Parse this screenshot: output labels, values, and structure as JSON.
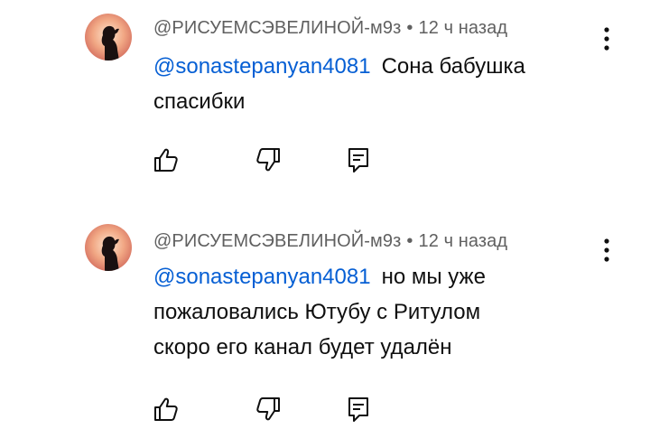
{
  "comments": [
    {
      "author": "@РИСУЕМСЭВЕЛИНОЙ-м9з",
      "separator": "•",
      "time": "12 ч назад",
      "mention": "@sonastepanyan4081",
      "lines": [
        "Сона бабушка",
        "спасибки"
      ]
    },
    {
      "author": "@РИСУЕМСЭВЕЛИНОЙ-м9з",
      "separator": "•",
      "time": "12 ч назад",
      "mention": "@sonastepanyan4081",
      "lines": [
        "но мы уже",
        "пожаловались Ютубу с Ритулом",
        "скоро его канал будет удалён"
      ]
    }
  ],
  "icons": {
    "avatar": "avatar-image",
    "menu": "more-vert-icon",
    "like": "thumb-up-icon",
    "dislike": "thumb-down-icon",
    "reply": "reply-icon"
  },
  "colors": {
    "mention": "#065fd4",
    "meta": "#606060",
    "text": "#0f0f0f"
  }
}
